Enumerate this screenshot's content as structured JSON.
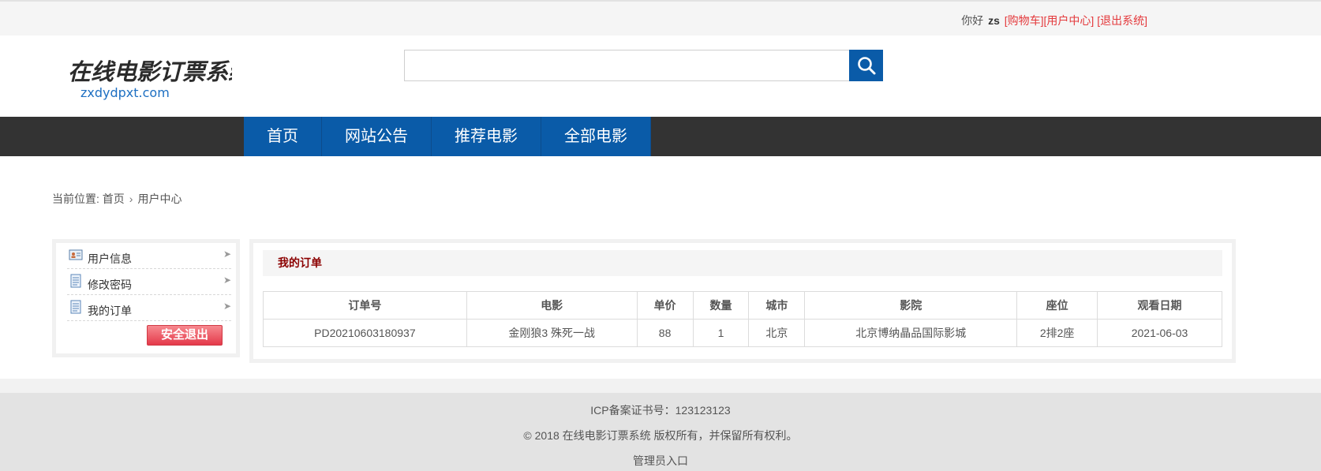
{
  "topbar": {
    "greeting": "你好",
    "username": "zs",
    "cart_link": "[购物车]",
    "user_center_link": "[用户中心]",
    "logout_link": "[退出系统]"
  },
  "header": {
    "logo_title": "在线电影订票系统",
    "logo_domain": "zxdydpxt.com",
    "search": {
      "value": "",
      "placeholder": ""
    }
  },
  "nav": {
    "items": [
      {
        "label": "首页"
      },
      {
        "label": "网站公告"
      },
      {
        "label": "推荐电影"
      },
      {
        "label": "全部电影"
      }
    ]
  },
  "breadcrumb": {
    "prefix": "当前位置:",
    "home": "首页",
    "separator": "›",
    "current": "用户中心"
  },
  "sidebar": {
    "items": [
      {
        "label": "用户信息",
        "icon": "id-card-icon"
      },
      {
        "label": "修改密码",
        "icon": "document-icon"
      },
      {
        "label": "我的订单",
        "icon": "document-icon"
      }
    ],
    "logout_button": "安全退出"
  },
  "orders": {
    "title": "我的订单",
    "columns": [
      "订单号",
      "电影",
      "单价",
      "数量",
      "城市",
      "影院",
      "座位",
      "观看日期"
    ],
    "rows": [
      {
        "order_no": "PD20210603180937",
        "movie": "金刚狼3 殊死一战",
        "price": "88",
        "quantity": "1",
        "city": "北京",
        "cinema": "北京博纳晶品国际影城",
        "seat": "2排2座",
        "date": "2021-06-03"
      }
    ]
  },
  "footer": {
    "icp": "ICP备案证书号：123123123",
    "copyright": "© 2018 在线电影订票系统 版权所有，并保留所有权利。",
    "admin_link": "管理员入口"
  },
  "colors": {
    "primary_blue": "#0a5ba8",
    "nav_bg": "#333333",
    "link_red": "#e4393c",
    "panel_title": "#8b0000"
  }
}
